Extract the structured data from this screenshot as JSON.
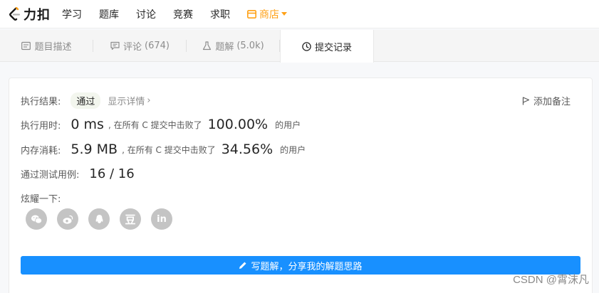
{
  "nav": {
    "logo_text": "力扣",
    "items": [
      "学习",
      "题库",
      "讨论",
      "竞赛",
      "求职"
    ],
    "store_label": "商店"
  },
  "tabs": [
    {
      "label": "题目描述",
      "count": "",
      "icon": "document-icon"
    },
    {
      "label": "评论",
      "count": "(674)",
      "icon": "comment-icon"
    },
    {
      "label": "题解",
      "count": "(5.0k)",
      "icon": "flask-icon"
    },
    {
      "label": "提交记录",
      "count": "",
      "icon": "clock-icon"
    }
  ],
  "result": {
    "label": "执行结果:",
    "status": "通过",
    "details_link": "显示详情",
    "add_note": "添加备注"
  },
  "runtime": {
    "label": "执行用时:",
    "value": "0 ms",
    "mid": ", 在所有 C 提交中击败了",
    "percent": "100.00%",
    "suffix": "的用户"
  },
  "memory": {
    "label": "内存消耗:",
    "value": "5.9 MB",
    "mid": ", 在所有 C 提交中击败了",
    "percent": "34.56%",
    "suffix": "的用户"
  },
  "tests": {
    "label": "通过测试用例:",
    "value": "16 / 16"
  },
  "share": {
    "label": "炫耀一下:",
    "icons": [
      "wechat-icon",
      "weibo-icon",
      "qq-icon",
      "douban-icon",
      "linkedin-icon"
    ],
    "douban_glyph": "豆",
    "linkedin_glyph": "in"
  },
  "solution_button": "写题解，分享我的解题思路",
  "watermark": "CSDN @霄沫凡",
  "colors": {
    "accent": "#ffa116",
    "primary_button": "#1890ff",
    "share_icon": "#c4c4c4"
  }
}
